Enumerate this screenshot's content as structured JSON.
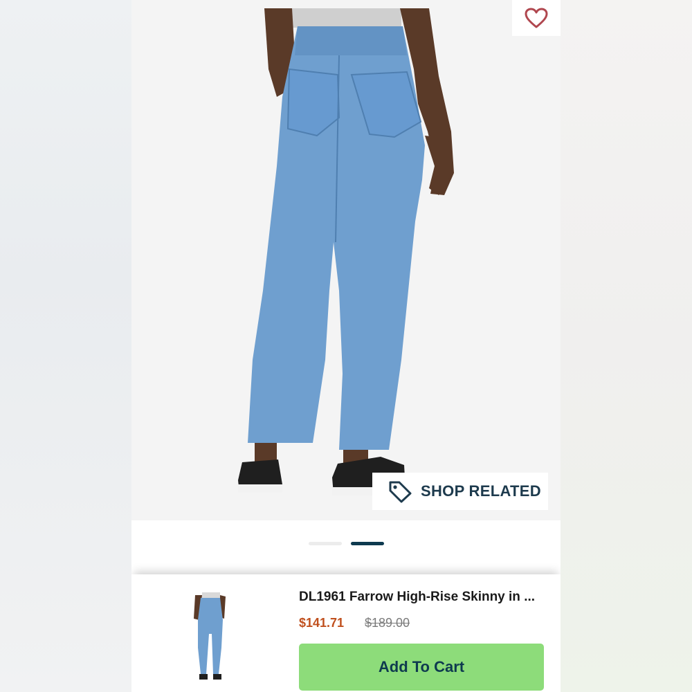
{
  "gallery": {
    "image_alt": "Model wearing light-wash high-rise skinny jeans, rear view",
    "slides_total": 2,
    "active_slide": 2
  },
  "actions": {
    "favorite_icon": "heart-outline-icon",
    "shop_related_icon": "tag-icon",
    "shop_related_label": "SHOP RELATED"
  },
  "product": {
    "title": "DL1961 Farrow High-Rise Skinny in ...",
    "sale_price": "$141.71",
    "original_price": "$189.00",
    "add_to_cart_label": "Add To Cart"
  },
  "colors": {
    "accent_navy": "#0e3a4f",
    "sale_price": "#c0501e",
    "cart_button": "#8ddc7a",
    "heart": "#b0474f"
  }
}
